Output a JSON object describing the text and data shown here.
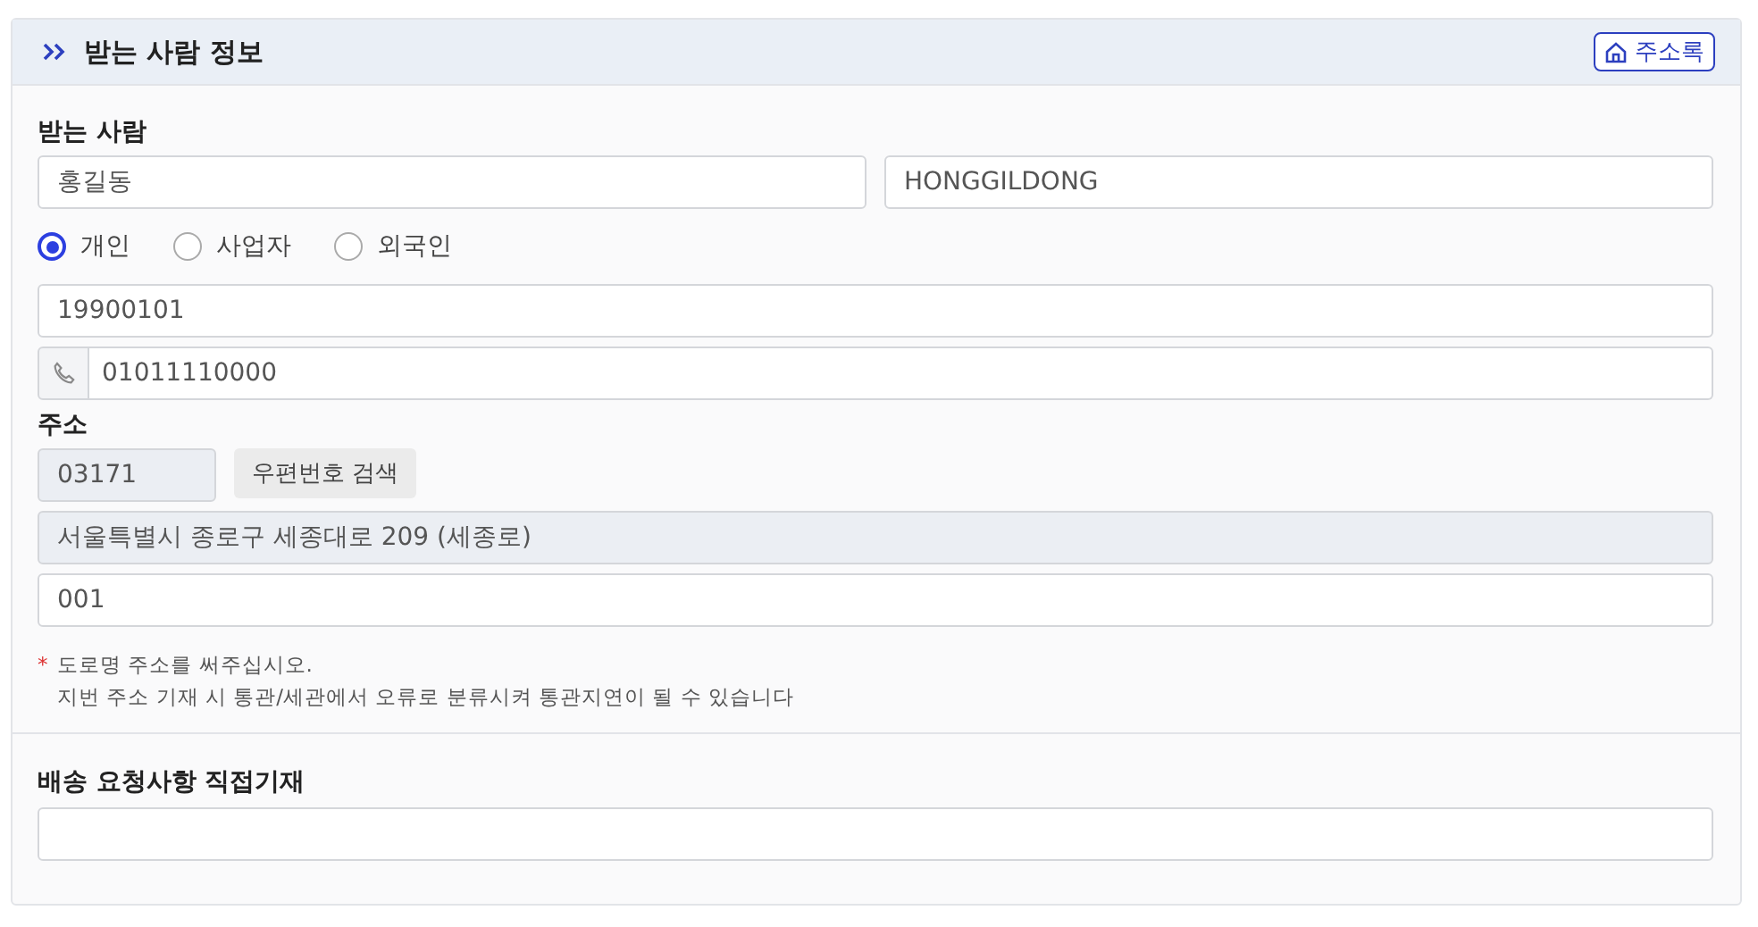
{
  "header": {
    "title": "받는 사람 정보",
    "address_book_button": "주소록"
  },
  "recipient": {
    "label": "받는 사람",
    "name_field": {
      "value": "홍길동"
    },
    "english_name_field": {
      "value": "HONGGILDONG"
    },
    "types": [
      {
        "label": "개인",
        "selected": true
      },
      {
        "label": "사업자",
        "selected": false
      },
      {
        "label": "외국인",
        "selected": false
      }
    ],
    "id_field": {
      "value": "19900101"
    },
    "phone_field": {
      "value": "01011110000"
    }
  },
  "address": {
    "label": "주소",
    "zip_field": {
      "value": "03171"
    },
    "search_button": "우편번호 검색",
    "road_address_field": {
      "value": "서울특별시 종로구 세종대로 209 (세종로)"
    },
    "detail_field": {
      "value": "001"
    },
    "notes": [
      {
        "marker": "*",
        "text": "도로명 주소를 써주십시오."
      },
      {
        "text": "지번 주소 기재 시 통관/세관에서 오류로 분류시켜 통관지연이 될 수 있습니다"
      }
    ]
  },
  "delivery_request": {
    "label": "배송 요청사항 직접기재"
  }
}
